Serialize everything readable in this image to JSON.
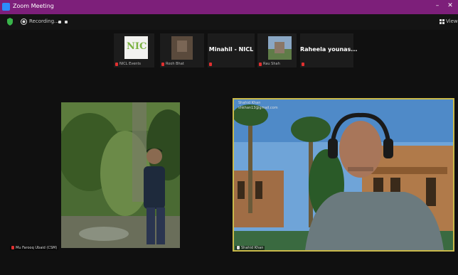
{
  "window": {
    "title": "Zoom Meeting",
    "min_glyph": "–",
    "close_glyph": "✕"
  },
  "toolbar": {
    "recording_label": "Recording...",
    "view_label": "View"
  },
  "participants_strip": [
    {
      "name": "NICL Events"
    },
    {
      "name": "Rooh Bhat"
    },
    {
      "big_name": "Minahil - NICL"
    },
    {
      "name": "Rau Shah"
    },
    {
      "big_name": "Raheela younas..."
    }
  ],
  "main_left": {
    "label": "Mu Farooq Ubaid (CSM)"
  },
  "main_right": {
    "overlay_name": "Shahid Khan",
    "overlay_email": "shkhan13@gmail.com",
    "label": "Shahid Khan"
  },
  "colors": {
    "title_bar": "#7d1f7a",
    "active_speaker_border": "#c9b94a",
    "mic_muted": "#e03030"
  }
}
